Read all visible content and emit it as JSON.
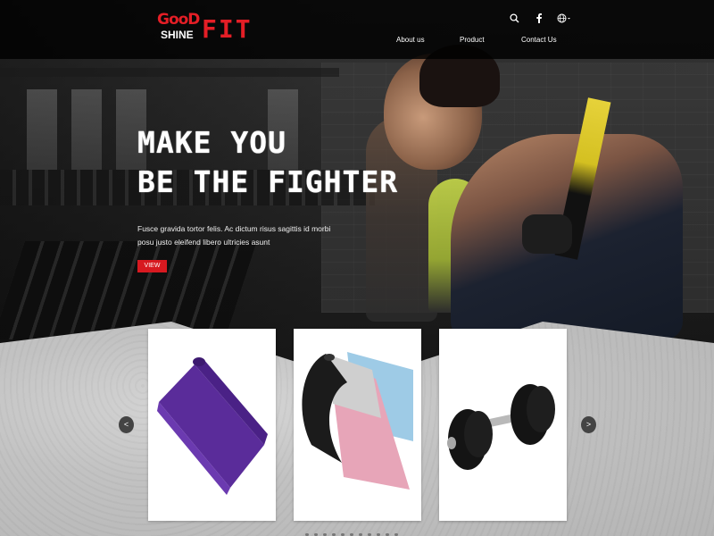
{
  "header": {
    "logo": {
      "line1": "GooD",
      "line2": "SHINE",
      "line3": "FIT"
    },
    "nav": [
      {
        "label": "About us"
      },
      {
        "label": "Product"
      },
      {
        "label": "Contact Us"
      }
    ],
    "icons": [
      "search-icon",
      "facebook-icon",
      "globe-icon"
    ]
  },
  "hero": {
    "title_line1": "MAKE YOU",
    "title_line2": "BE THE FIGHTER",
    "description": "Fusce gravida tortor felis. Ac dictum risus sagittis id morbi posu justo eleifend libero ultricies asunt",
    "button_label": "VIEW"
  },
  "products": {
    "items": [
      {
        "name": "purple-yoga-mat",
        "color": "#5b2a9c"
      },
      {
        "name": "pink-blue-yoga-mats",
        "color": "#e7a5b8"
      },
      {
        "name": "dumbbell",
        "color": "#141414"
      }
    ],
    "prev_label": "<",
    "next_label": ">",
    "dot_count": 11
  },
  "colors": {
    "accent": "#d71920",
    "header_bg": "#000000"
  }
}
